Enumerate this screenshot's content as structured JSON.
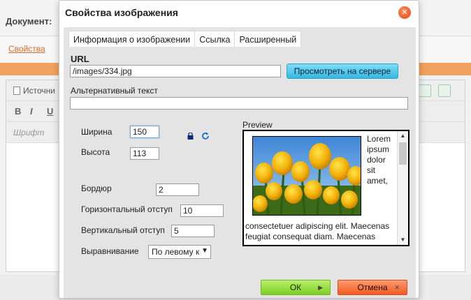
{
  "background": {
    "document_label": "Документ:",
    "properties_tab": "Свойства",
    "source_button": "Источни",
    "format_buttons": [
      "B",
      "I",
      "U"
    ],
    "font_placeholder": "Шрифт"
  },
  "dialog": {
    "title": "Свойства изображения",
    "close_icon": "close-icon",
    "tabs": [
      {
        "label": "Информация о изображении",
        "active": true
      },
      {
        "label": "Ссылка",
        "active": false
      },
      {
        "label": "Расширенный",
        "active": false
      }
    ],
    "url": {
      "label": "URL",
      "value": "/images/334.jpg",
      "browse_button": "Просмотреть на сервере"
    },
    "alt_text": {
      "label": "Альтернативный текст",
      "value": ""
    },
    "width": {
      "label": "Ширина",
      "value": "150"
    },
    "height": {
      "label": "Высота",
      "value": "113"
    },
    "lock_icon": "lock-icon",
    "reset_icon": "reset-size-icon",
    "border": {
      "label": "Бордюр",
      "value": "2"
    },
    "hspace": {
      "label": "Горизонтальный отступ",
      "value": "10"
    },
    "vspace": {
      "label": "Вертикальный отступ",
      "value": "5"
    },
    "align": {
      "label": "Выравнивание",
      "value": "По левому к"
    },
    "preview": {
      "label": "Preview",
      "side_text": "Lorem ipsum dolor sit amet,",
      "body_text": "consectetuer adipiscing elit. Maecenas feugiat consequat diam. Maecenas"
    },
    "ok_button": "ОК",
    "cancel_button": "Отмена"
  },
  "colors": {
    "accent_orange": "#f1a25e",
    "close_button": "#e24a10",
    "browse_button": "#35b8e2",
    "ok_button": "#7cce25",
    "cancel_button": "#f15a22"
  }
}
